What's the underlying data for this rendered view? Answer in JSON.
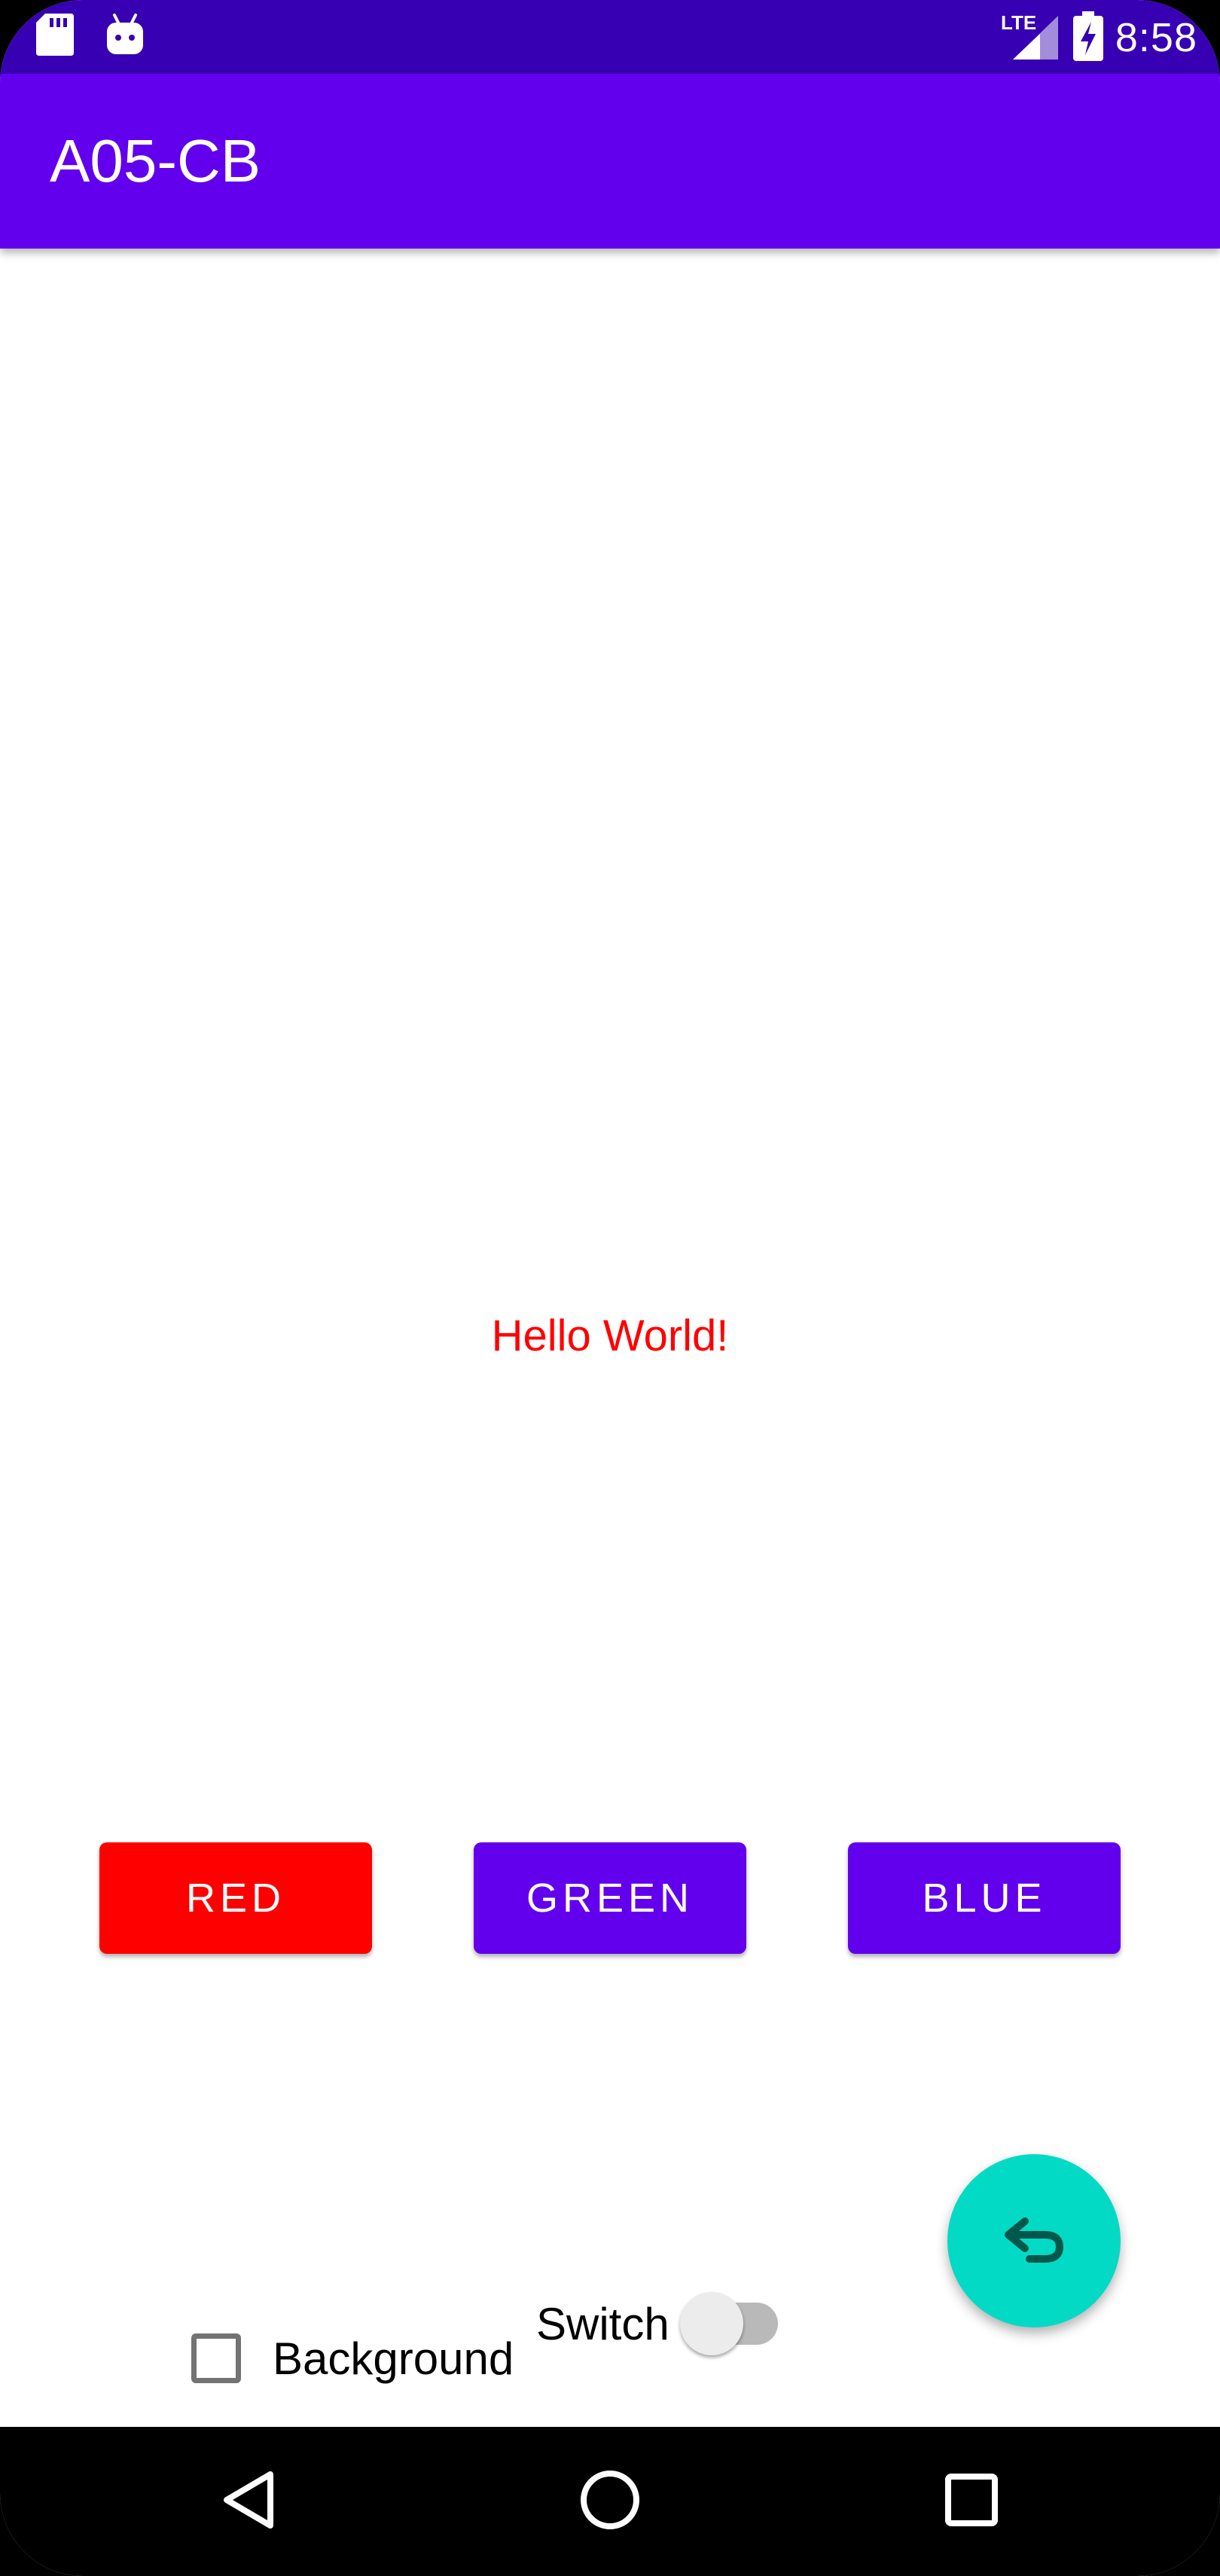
{
  "status_bar": {
    "time": "8:58",
    "network": "LTE",
    "icons": [
      "sd-card-icon",
      "android-icon",
      "lte-signal-icon",
      "battery-charging-icon"
    ]
  },
  "app_bar": {
    "title": "A05-CB",
    "color": "#6200ee"
  },
  "main": {
    "hello_text": "Hello World!",
    "hello_color": "#ff0000"
  },
  "buttons": [
    {
      "label": "RED",
      "color": "#ff0000"
    },
    {
      "label": "GREEN",
      "color": "#6200ee"
    },
    {
      "label": "BLUE",
      "color": "#6200ee"
    }
  ],
  "fab": {
    "icon": "undo-icon",
    "color": "#03dac5"
  },
  "checkbox": {
    "label": "Background",
    "checked": false
  },
  "switch": {
    "label": "Switch",
    "on": false
  },
  "nav_bar": {
    "icons": [
      "back-icon",
      "home-icon",
      "recents-icon"
    ]
  }
}
